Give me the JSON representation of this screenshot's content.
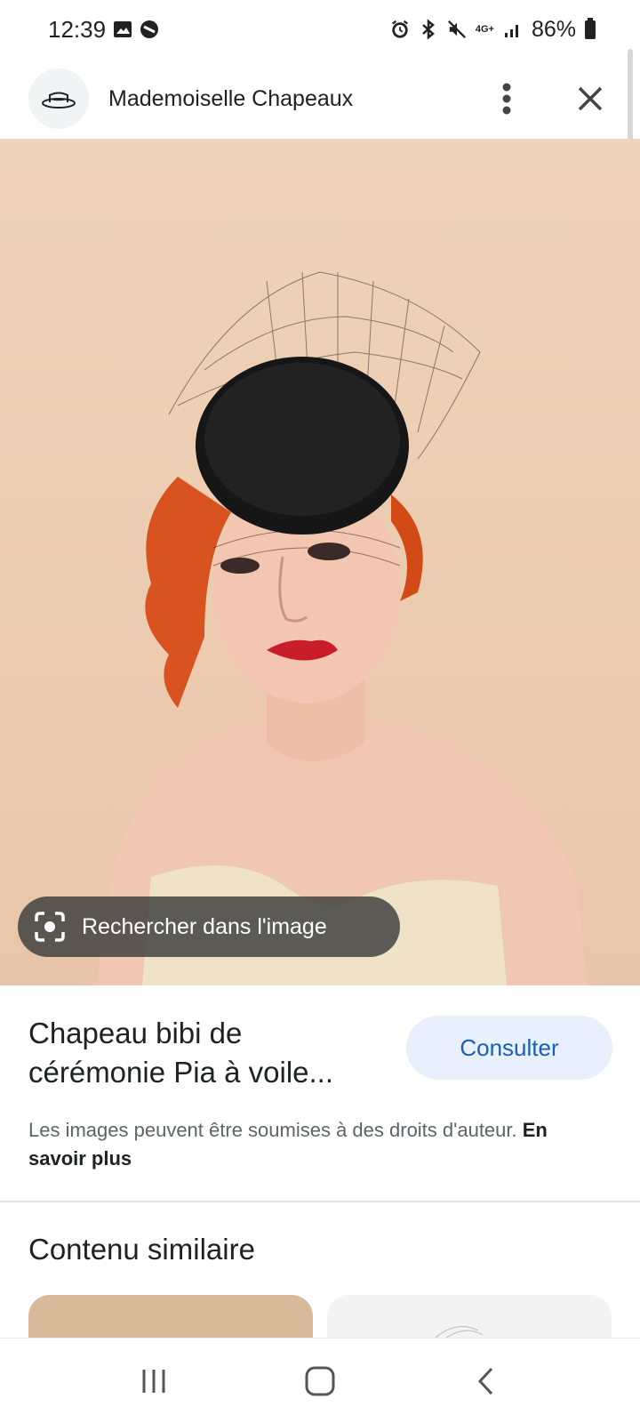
{
  "status_bar": {
    "time": "12:39",
    "network": "4G+",
    "battery": "86%"
  },
  "header": {
    "site_name": "Mademoiselle Chapeaux",
    "logo_icon": "hat-icon",
    "menu_icon": "more-vert-icon",
    "close_icon": "close-icon"
  },
  "image": {
    "lens_label": "Rechercher dans l'image"
  },
  "result": {
    "title": "Chapeau bibi de cérémonie Pia à voile...",
    "consult_label": "Consulter",
    "copyright_text": "Les images peuvent être soumises à des droits d'auteur.",
    "learn_more": "En savoir plus"
  },
  "similar": {
    "heading": "Contenu similaire"
  },
  "colors": {
    "accent": "#1a5fb4",
    "pill_bg": "#e8f0fe",
    "image_bg": "#edcdb2"
  }
}
